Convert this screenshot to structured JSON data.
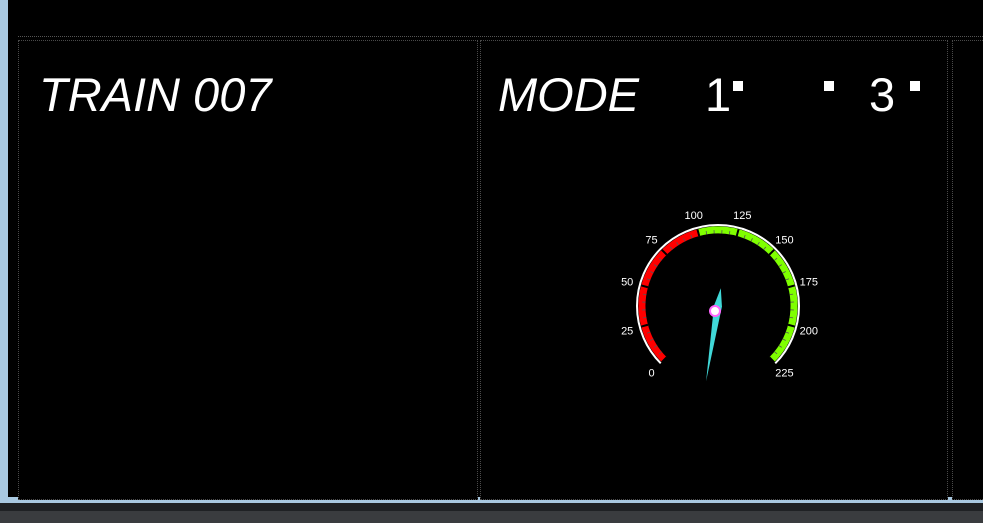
{
  "train_panel": {
    "title": "TRAIN 007"
  },
  "mode_panel": {
    "title": "MODE",
    "mode_numbers": [
      "1",
      "3"
    ]
  },
  "speedometer": {
    "min": 0,
    "max": 225,
    "labels": [
      "0",
      "25",
      "50",
      "75",
      "100",
      "125",
      "150",
      "175",
      "200",
      "225"
    ],
    "red_range": [
      0,
      100
    ],
    "green_range": [
      100,
      225
    ],
    "needle_value": 120,
    "colors": {
      "red": "#ff0000",
      "green": "#7fff00",
      "needle": "#40d8d8",
      "hub": "#ff66ff"
    }
  }
}
